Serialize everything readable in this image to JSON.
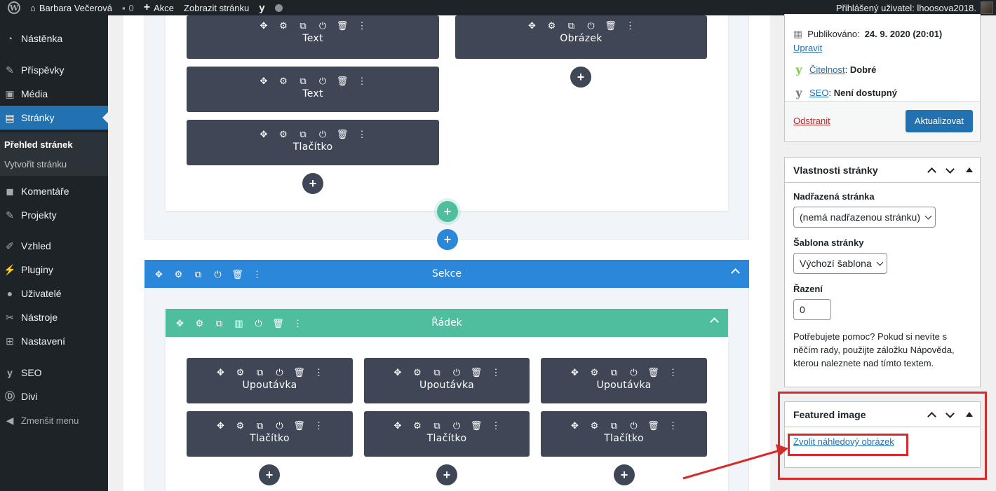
{
  "admin_bar": {
    "site_name": "Barbara Večerová",
    "comments_count": "0",
    "new_label": "Akce",
    "view_page": "Zobrazit stránku",
    "user_greeting": "Přihlášený uživatel: lhoosova2018."
  },
  "admin_menu": {
    "items": [
      {
        "label": "Nástěnka",
        "icon": "dashboard-icon"
      },
      {
        "label": "Příspěvky",
        "icon": "pin-icon"
      },
      {
        "label": "Média",
        "icon": "media-icon"
      },
      {
        "label": "Stránky",
        "icon": "pages-icon"
      },
      {
        "label": "Komentáře",
        "icon": "comments-icon"
      },
      {
        "label": "Projekty",
        "icon": "pin-icon"
      },
      {
        "label": "Vzhled",
        "icon": "brush-icon"
      },
      {
        "label": "Pluginy",
        "icon": "plugin-icon"
      },
      {
        "label": "Uživatelé",
        "icon": "users-icon"
      },
      {
        "label": "Nástroje",
        "icon": "wrench-icon"
      },
      {
        "label": "Nastavení",
        "icon": "settings-icon"
      },
      {
        "label": "SEO",
        "icon": "yoast-icon"
      },
      {
        "label": "Divi",
        "icon": "divi-icon"
      }
    ],
    "submenu": [
      "Přehled stránek",
      "Vytvořit stránku"
    ],
    "collapse": "Zmenšit menu"
  },
  "builder": {
    "col1_modules": [
      "Text",
      "Text",
      "Tlačítko"
    ],
    "col2_modules": [
      "Obrázek"
    ],
    "section_label": "Sekce",
    "row_label": "Řádek",
    "row_modules": [
      [
        "Upoutávka",
        "Tlačítko"
      ],
      [
        "Upoutávka",
        "Tlačítko"
      ],
      [
        "Upoutávka",
        "Tlačítko"
      ]
    ],
    "colors": {
      "section_bar": "#2b87da",
      "row_bar": "#4fbe9f",
      "module": "#3f4655"
    }
  },
  "publish": {
    "published_label": "Publikováno:",
    "published_date": "24. 9. 2020 (20:01)",
    "edit_link": "Upravit",
    "readability_label": "Čitelnost",
    "readability_value": "Dobré",
    "seo_label": "SEO",
    "seo_value": "Není dostupný",
    "delete_link": "Odstranit",
    "update_button": "Aktualizovat"
  },
  "page_attributes": {
    "title": "Vlastnosti stránky",
    "parent_label": "Nadřazená stránka",
    "parent_value": "(nemá nadřazenou stránku)",
    "template_label": "Šablona stránky",
    "template_value": "Výchozí šablona",
    "order_label": "Řazení",
    "order_value": "0",
    "help_text": "Potřebujete pomoc? Pokud si nevíte s něčím rady, použijte záložku Nápověda, kterou naleznete nad tímto textem."
  },
  "featured_image": {
    "title": "Featured image",
    "set_link": "Zvolit náhledový obrázek"
  },
  "annotation": {
    "color": "#d62b2b"
  }
}
